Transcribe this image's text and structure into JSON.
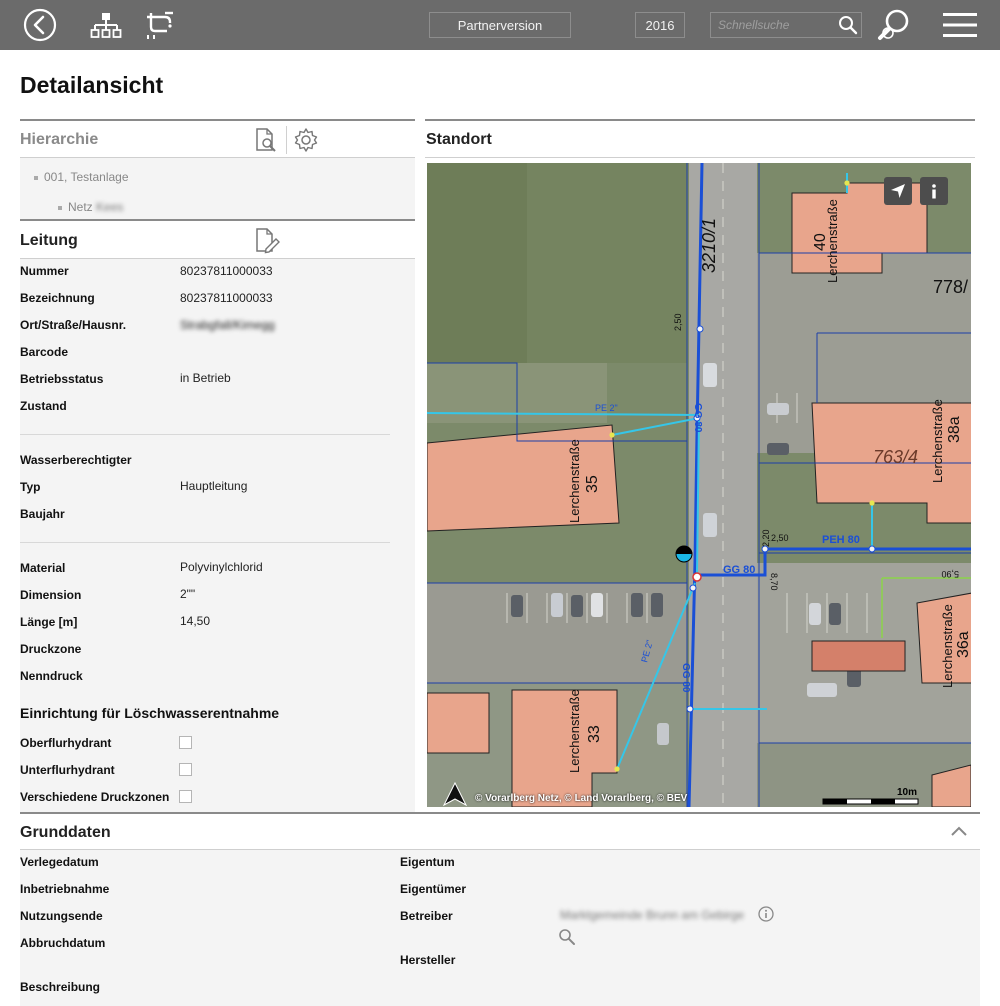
{
  "topbar": {
    "back_icon": "back-circle-icon",
    "hierarchy_icon": "hierarchy-icon",
    "network_icon": "pipe-network-icon",
    "partner_label": "Partnerversion",
    "year_label": "2016",
    "search_placeholder": "Schnellsuche",
    "search_icon": "search-icon",
    "advanced_search_icon": "advanced-search-icon",
    "menu_icon": "hamburger-menu-icon"
  },
  "page_title": "Detailansicht",
  "hierarchy": {
    "title": "Hierarchie",
    "items": [
      {
        "label": "001, Testanlage"
      },
      {
        "label": "Netz",
        "suffix": "Kees"
      }
    ]
  },
  "leitung": {
    "title": "Leitung",
    "fields": [
      {
        "label": "Nummer",
        "value": "80237811000033"
      },
      {
        "label": "Bezeichnung",
        "value": "80237811000033"
      },
      {
        "label": "Ort/Straße/Hausnr.",
        "value": "Strabgfall/Kimegg"
      },
      {
        "label": "Barcode",
        "value": ""
      },
      {
        "label": "Betriebsstatus",
        "value": "in Betrieb"
      },
      {
        "label": "Zustand",
        "value": ""
      },
      {
        "label": "Wasserberechtigter",
        "value": ""
      },
      {
        "label": "Typ",
        "value": "Hauptleitung"
      },
      {
        "label": "Baujahr",
        "value": ""
      },
      {
        "label": "Material",
        "value": "Polyvinylchlorid"
      },
      {
        "label": "Dimension",
        "value": "2\"\""
      },
      {
        "label": "Länge [m]",
        "value": "14,50"
      },
      {
        "label": "Druckzone",
        "value": ""
      },
      {
        "label": "Nenndruck",
        "value": ""
      }
    ],
    "loesch_title": "Einrichtung für Löschwasserentnahme",
    "checkboxes": [
      {
        "label": "Oberflurhydrant",
        "checked": false
      },
      {
        "label": "Unterflurhydrant",
        "checked": false
      },
      {
        "label": "Verschiedene Druckzonen",
        "checked": false
      }
    ]
  },
  "standort": {
    "title": "Standort",
    "attribution": "© Vorarlberg Netz, © Land Vorarlberg, © BEV",
    "scale_label": "10m",
    "map_labels": {
      "parcel_top": "3210/1",
      "parcel_right": "778/",
      "parcel_mid": "763/4",
      "house_40": "40",
      "house_38a": "38a",
      "house_35": "35",
      "house_36a": "36a",
      "house_33": "33",
      "street": "Lerchenstraße",
      "pipe_gg80": "GG 80",
      "pipe_peh80": "PEH 80",
      "pipe_pe": "PE 2\"",
      "dim_250": "2,50",
      "dim_220": "2,20",
      "dim_870": "8,70",
      "dim_590": "5,90"
    }
  },
  "grunddaten": {
    "title": "Grunddaten",
    "left_fields": [
      "Verlegedatum",
      "Inbetriebnahme",
      "Nutzungsende",
      "Abbruchdatum",
      "Beschreibung"
    ],
    "right_fields": [
      "Eigentum",
      "Eigentümer",
      "Betreiber",
      "Hersteller"
    ],
    "betreiber_value": "Marktgemeinde Brunn am Gebirge"
  },
  "colors": {
    "topbar": "#6b6b6b",
    "panel_bg": "#f4f4f4",
    "pipe_main": "#1a4fd6",
    "pipe_service": "#35c6e8"
  }
}
